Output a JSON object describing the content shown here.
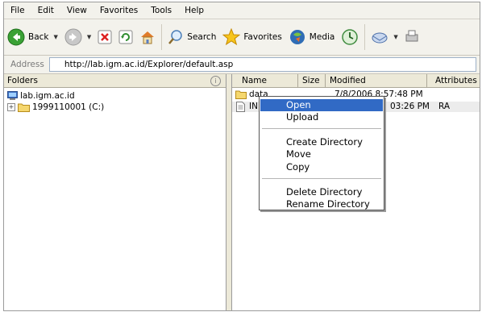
{
  "menu": [
    "File",
    "Edit",
    "View",
    "Favorites",
    "Tools",
    "Help"
  ],
  "toolbar": {
    "back": "Back",
    "search": "Search",
    "favorites": "Favorites",
    "media": "Media"
  },
  "address": {
    "label": "Address",
    "url": "http://lab.igm.ac.id/Explorer/default.asp"
  },
  "folders": {
    "title": "Folders",
    "root": "lab.igm.ac.id",
    "drive": "1999110001 (C:)",
    "expander": "+"
  },
  "columns": [
    "Name",
    "Size",
    "Modified",
    "Attributes"
  ],
  "files": [
    {
      "name": "data",
      "size": "",
      "modified": "7/8/2006 8:57:48 PM",
      "attributes": ""
    },
    {
      "name": "INF",
      "size": "",
      "modified": "03:26 PM",
      "attributes": "RA"
    }
  ],
  "context_menu": {
    "open": "Open",
    "upload": "Upload",
    "create_directory": "Create Directory",
    "move": "Move",
    "copy": "Copy",
    "delete_directory": "Delete Directory",
    "rename_directory": "Rename Directory"
  },
  "colors": {
    "highlight": "#316ac5",
    "folder": "#f5d76e"
  }
}
